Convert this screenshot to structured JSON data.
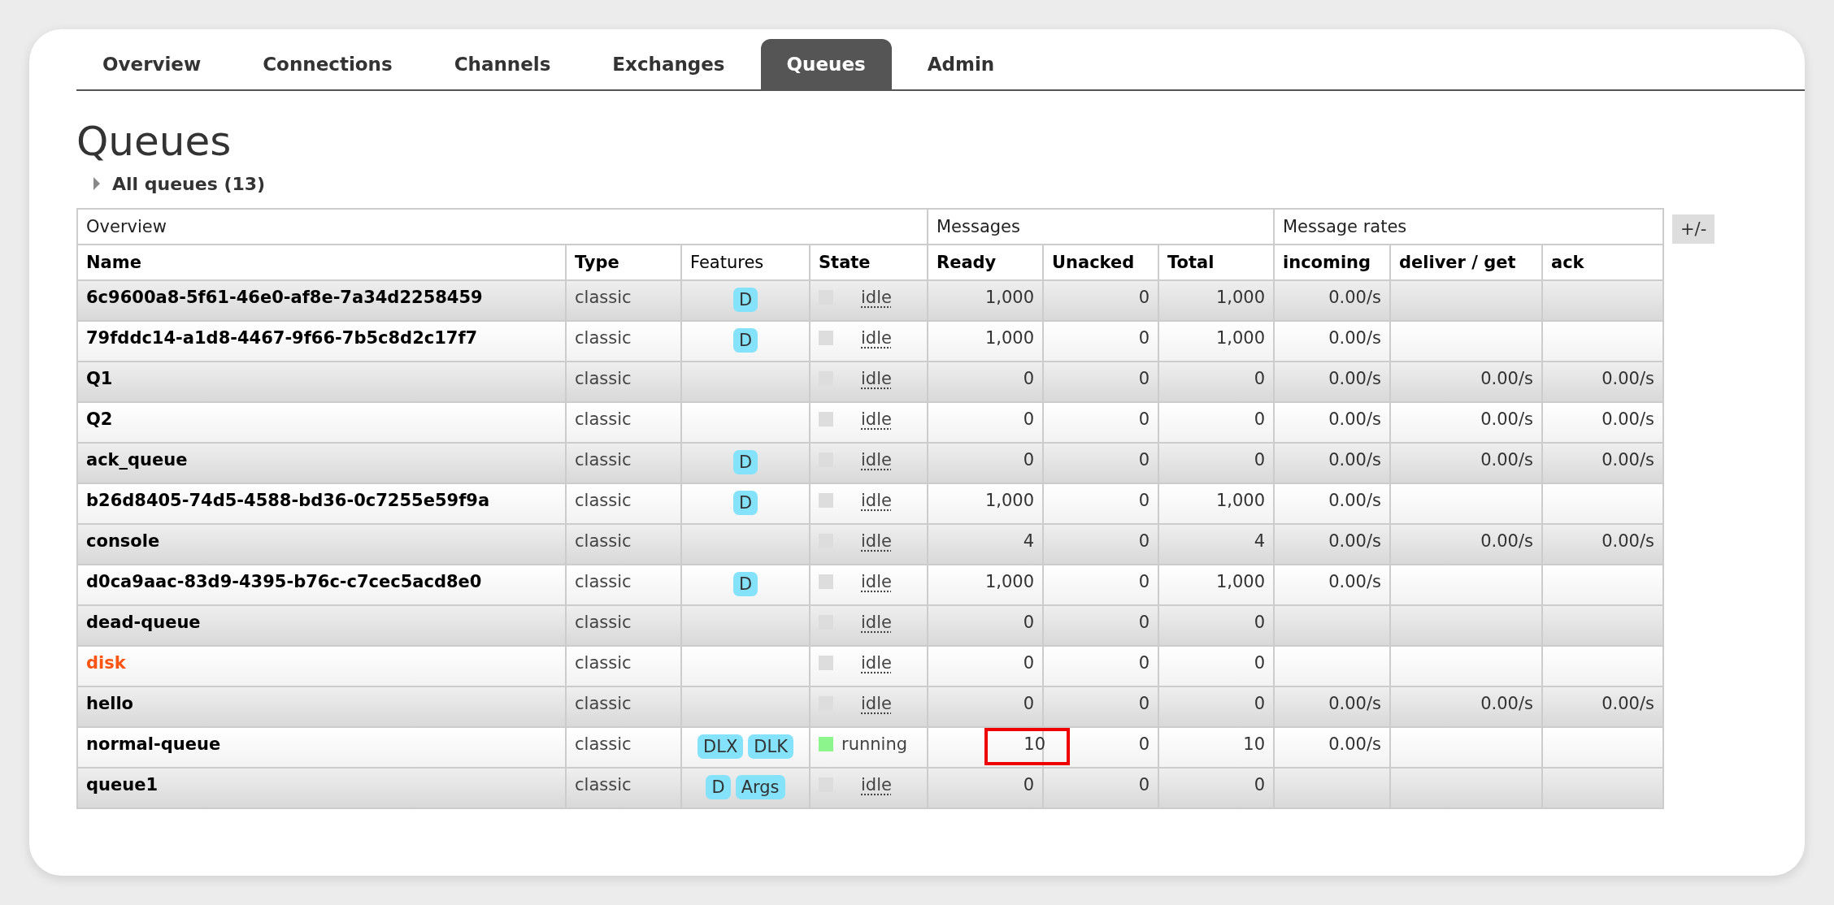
{
  "tabs": [
    {
      "label": "Overview",
      "selected": false
    },
    {
      "label": "Connections",
      "selected": false
    },
    {
      "label": "Channels",
      "selected": false
    },
    {
      "label": "Exchanges",
      "selected": false
    },
    {
      "label": "Queues",
      "selected": true
    },
    {
      "label": "Admin",
      "selected": false
    }
  ],
  "page_title": "Queues",
  "section": {
    "label": "All queues (13)",
    "expanded": false
  },
  "table": {
    "groups": [
      {
        "label": "Overview"
      },
      {
        "label": "Messages"
      },
      {
        "label": "Message rates"
      }
    ],
    "columns": [
      {
        "label": "Name",
        "bold": true
      },
      {
        "label": "Type",
        "bold": true
      },
      {
        "label": "Features",
        "bold": false
      },
      {
        "label": "State",
        "bold": true
      },
      {
        "label": "Ready",
        "bold": true
      },
      {
        "label": "Unacked",
        "bold": true
      },
      {
        "label": "Total",
        "bold": true
      },
      {
        "label": "incoming",
        "bold": true
      },
      {
        "label": "deliver / get",
        "bold": true
      },
      {
        "label": "ack",
        "bold": true
      }
    ],
    "toggle_button": "+/-",
    "rows": [
      {
        "name": "6c9600a8-5f61-46e0-af8e-7a34d2258459",
        "warning": false,
        "type": "classic",
        "features": [
          "D"
        ],
        "state": {
          "kind": "idle",
          "label": "idle",
          "color": "#dddddd"
        },
        "ready": "1,000",
        "ready_highlighted": false,
        "unacked": "0",
        "total": "1,000",
        "incoming": "0.00/s",
        "deliver_get": "",
        "ack": ""
      },
      {
        "name": "79fddc14-a1d8-4467-9f66-7b5c8d2c17f7",
        "warning": false,
        "type": "classic",
        "features": [
          "D"
        ],
        "state": {
          "kind": "idle",
          "label": "idle",
          "color": "#dddddd"
        },
        "ready": "1,000",
        "ready_highlighted": false,
        "unacked": "0",
        "total": "1,000",
        "incoming": "0.00/s",
        "deliver_get": "",
        "ack": ""
      },
      {
        "name": "Q1",
        "warning": false,
        "type": "classic",
        "features": [],
        "state": {
          "kind": "idle",
          "label": "idle",
          "color": "#dddddd"
        },
        "ready": "0",
        "ready_highlighted": false,
        "unacked": "0",
        "total": "0",
        "incoming": "0.00/s",
        "deliver_get": "0.00/s",
        "ack": "0.00/s"
      },
      {
        "name": "Q2",
        "warning": false,
        "type": "classic",
        "features": [],
        "state": {
          "kind": "idle",
          "label": "idle",
          "color": "#dddddd"
        },
        "ready": "0",
        "ready_highlighted": false,
        "unacked": "0",
        "total": "0",
        "incoming": "0.00/s",
        "deliver_get": "0.00/s",
        "ack": "0.00/s"
      },
      {
        "name": "ack_queue",
        "warning": false,
        "type": "classic",
        "features": [
          "D"
        ],
        "state": {
          "kind": "idle",
          "label": "idle",
          "color": "#dddddd"
        },
        "ready": "0",
        "ready_highlighted": false,
        "unacked": "0",
        "total": "0",
        "incoming": "0.00/s",
        "deliver_get": "0.00/s",
        "ack": "0.00/s"
      },
      {
        "name": "b26d8405-74d5-4588-bd36-0c7255e59f9a",
        "warning": false,
        "type": "classic",
        "features": [
          "D"
        ],
        "state": {
          "kind": "idle",
          "label": "idle",
          "color": "#dddddd"
        },
        "ready": "1,000",
        "ready_highlighted": false,
        "unacked": "0",
        "total": "1,000",
        "incoming": "0.00/s",
        "deliver_get": "",
        "ack": ""
      },
      {
        "name": "console",
        "warning": false,
        "type": "classic",
        "features": [],
        "state": {
          "kind": "idle",
          "label": "idle",
          "color": "#dddddd"
        },
        "ready": "4",
        "ready_highlighted": false,
        "unacked": "0",
        "total": "4",
        "incoming": "0.00/s",
        "deliver_get": "0.00/s",
        "ack": "0.00/s"
      },
      {
        "name": "d0ca9aac-83d9-4395-b76c-c7cec5acd8e0",
        "warning": false,
        "type": "classic",
        "features": [
          "D"
        ],
        "state": {
          "kind": "idle",
          "label": "idle",
          "color": "#dddddd"
        },
        "ready": "1,000",
        "ready_highlighted": false,
        "unacked": "0",
        "total": "1,000",
        "incoming": "0.00/s",
        "deliver_get": "",
        "ack": ""
      },
      {
        "name": "dead-queue",
        "warning": false,
        "type": "classic",
        "features": [],
        "state": {
          "kind": "idle",
          "label": "idle",
          "color": "#dddddd"
        },
        "ready": "0",
        "ready_highlighted": false,
        "unacked": "0",
        "total": "0",
        "incoming": "",
        "deliver_get": "",
        "ack": ""
      },
      {
        "name": "disk",
        "warning": true,
        "type": "classic",
        "features": [],
        "state": {
          "kind": "idle",
          "label": "idle",
          "color": "#dddddd"
        },
        "ready": "0",
        "ready_highlighted": false,
        "unacked": "0",
        "total": "0",
        "incoming": "",
        "deliver_get": "",
        "ack": ""
      },
      {
        "name": "hello",
        "warning": false,
        "type": "classic",
        "features": [],
        "state": {
          "kind": "idle",
          "label": "idle",
          "color": "#dddddd"
        },
        "ready": "0",
        "ready_highlighted": false,
        "unacked": "0",
        "total": "0",
        "incoming": "0.00/s",
        "deliver_get": "0.00/s",
        "ack": "0.00/s"
      },
      {
        "name": "normal-queue",
        "warning": false,
        "type": "classic",
        "features": [
          "DLX",
          "DLK"
        ],
        "state": {
          "kind": "running",
          "label": "running",
          "color": "#8cf58c"
        },
        "ready": "10",
        "ready_highlighted": true,
        "unacked": "0",
        "total": "10",
        "incoming": "0.00/s",
        "deliver_get": "",
        "ack": ""
      },
      {
        "name": "queue1",
        "warning": false,
        "type": "classic",
        "features": [
          "D",
          "Args"
        ],
        "state": {
          "kind": "idle",
          "label": "idle",
          "color": "#dddddd"
        },
        "ready": "0",
        "ready_highlighted": false,
        "unacked": "0",
        "total": "0",
        "incoming": "",
        "deliver_get": "",
        "ack": ""
      }
    ]
  }
}
